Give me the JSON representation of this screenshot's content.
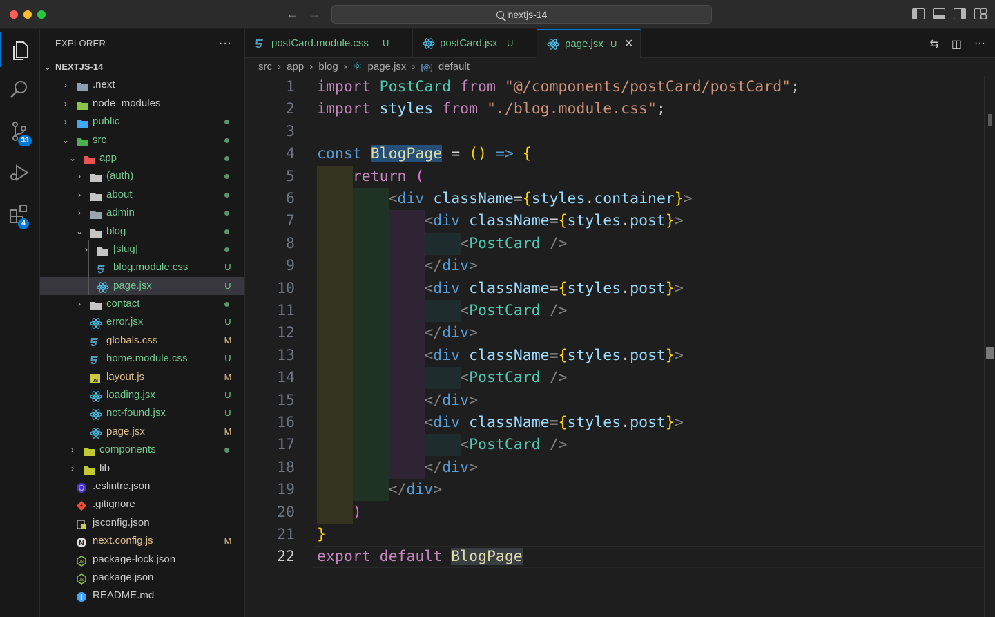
{
  "window": {
    "search_text": "nextjs-14"
  },
  "activity": {
    "scm_badge": "33",
    "extensions_badge": "4"
  },
  "explorer": {
    "header": "EXPLORER",
    "more": "···",
    "root": "NEXTJS-14",
    "items": [
      {
        "label": ".next",
        "status": "",
        "dot": false
      },
      {
        "label": "node_modules",
        "status": "",
        "dot": false
      },
      {
        "label": "public",
        "status": "",
        "dot": true
      },
      {
        "label": "src",
        "status": "",
        "dot": true
      },
      {
        "label": "app",
        "status": "",
        "dot": true
      },
      {
        "label": "(auth)",
        "status": "",
        "dot": true
      },
      {
        "label": "about",
        "status": "",
        "dot": true
      },
      {
        "label": "admin",
        "status": "",
        "dot": true
      },
      {
        "label": "blog",
        "status": "",
        "dot": true
      },
      {
        "label": "[slug]",
        "status": "",
        "dot": true
      },
      {
        "label": "blog.module.css",
        "status": "U",
        "dot": false
      },
      {
        "label": "page.jsx",
        "status": "U",
        "dot": false
      },
      {
        "label": "contact",
        "status": "",
        "dot": true
      },
      {
        "label": "error.jsx",
        "status": "U",
        "dot": false
      },
      {
        "label": "globals.css",
        "status": "M",
        "dot": false
      },
      {
        "label": "home.module.css",
        "status": "U",
        "dot": false
      },
      {
        "label": "layout.js",
        "status": "M",
        "dot": false
      },
      {
        "label": "loading.jsx",
        "status": "U",
        "dot": false
      },
      {
        "label": "not-found.jsx",
        "status": "U",
        "dot": false
      },
      {
        "label": "page.jsx",
        "status": "M",
        "dot": false
      },
      {
        "label": "components",
        "status": "",
        "dot": true
      },
      {
        "label": "lib",
        "status": "",
        "dot": false
      },
      {
        "label": ".eslintrc.json",
        "status": "",
        "dot": false
      },
      {
        "label": ".gitignore",
        "status": "",
        "dot": false
      },
      {
        "label": "jsconfig.json",
        "status": "",
        "dot": false
      },
      {
        "label": "next.config.js",
        "status": "M",
        "dot": false
      },
      {
        "label": "package-lock.json",
        "status": "",
        "dot": false
      },
      {
        "label": "package.json",
        "status": "",
        "dot": false
      },
      {
        "label": "README.md",
        "status": "",
        "dot": false
      }
    ]
  },
  "tabs": [
    {
      "label": "postCard.module.css",
      "status": "U"
    },
    {
      "label": "postCard.jsx",
      "status": "U"
    },
    {
      "label": "page.jsx",
      "status": "U",
      "close": "✕"
    }
  ],
  "breadcrumb": {
    "parts": [
      "src",
      "app",
      "blog",
      "page.jsx",
      "default"
    ]
  },
  "editor": {
    "line_numbers": [
      "1",
      "2",
      "3",
      "4",
      "5",
      "6",
      "7",
      "8",
      "9",
      "10",
      "11",
      "12",
      "13",
      "14",
      "15",
      "16",
      "17",
      "18",
      "19",
      "20",
      "21",
      "22"
    ],
    "tokens": {
      "import": "import",
      "from": "from",
      "postcard": "PostCard",
      "path1": "\"@/components/postCard/postCard\"",
      "styles": "styles",
      "path2": "\"./blog.module.css\"",
      "semi": ";",
      "const": "const",
      "blogpage": "BlogPage",
      "eq": " = ",
      "arrow_open": "(",
      "arrow_close": ")",
      "arrow": " => ",
      "brace_open": "{",
      "brace_close": "}",
      "return": "return",
      "paren_open": "(",
      "paren_close": ")",
      "lt": "<",
      "lt_slash": "</",
      "gt": ">",
      "self_close": " />",
      "div": "div",
      "classname": "className",
      "eq2": "=",
      "dot": ".",
      "container": "container",
      "post": "post",
      "export": "export",
      "default": "default"
    }
  }
}
